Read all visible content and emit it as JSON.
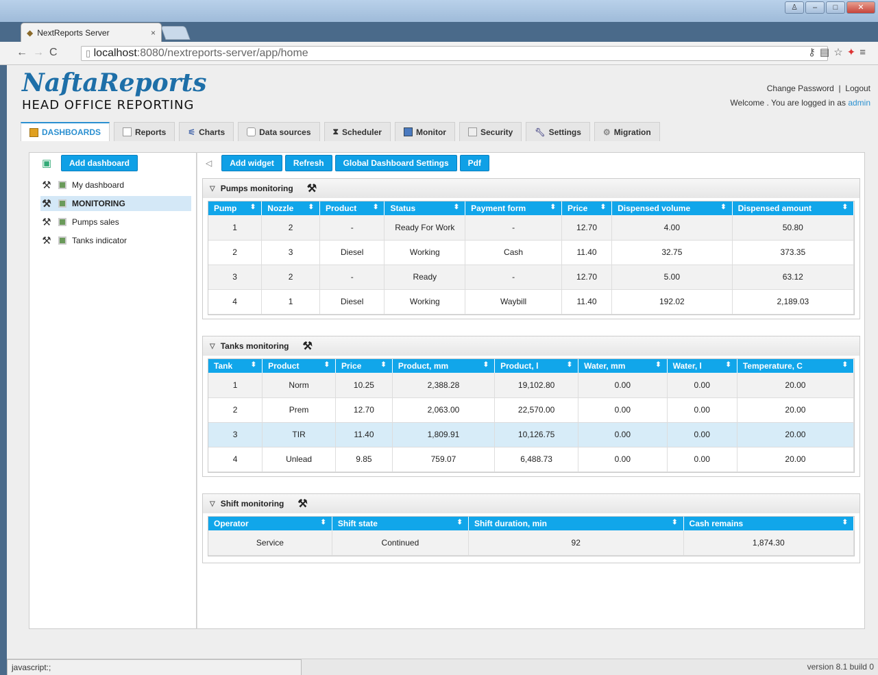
{
  "browser": {
    "tab_title": "NextReports Server",
    "url_host": "localhost",
    "url_rest": ":8080/nextreports-server/app/home",
    "close_glyph": "×"
  },
  "app": {
    "logo": "NaftaReports",
    "tagline": "HEAD OFFICE REPORTING",
    "change_password": "Change Password",
    "separator": "|",
    "logout": "Logout",
    "welcome": "Welcome . You are logged in as ",
    "user": "admin"
  },
  "nav_tabs": [
    {
      "label": "DASHBOARDS",
      "icon": "dashboard-icon"
    },
    {
      "label": "Reports",
      "icon": "reports-icon"
    },
    {
      "label": "Charts",
      "icon": "charts-icon"
    },
    {
      "label": "Data sources",
      "icon": "datasource-icon"
    },
    {
      "label": "Scheduler",
      "icon": "hourglass-icon"
    },
    {
      "label": "Monitor",
      "icon": "monitor-icon"
    },
    {
      "label": "Security",
      "icon": "security-icon"
    },
    {
      "label": "Settings",
      "icon": "wrench-icon"
    },
    {
      "label": "Migration",
      "icon": "migration-icon"
    }
  ],
  "sidebar": {
    "add_dashboard": "Add dashboard",
    "items": [
      "My dashboard",
      "MONITORING",
      "Pumps sales",
      "Tanks indicator"
    ]
  },
  "toolbar": {
    "add_widget": "Add widget",
    "refresh": "Refresh",
    "global_settings": "Global Dashboard Settings",
    "pdf": "Pdf"
  },
  "pumps": {
    "title": "Pumps monitoring",
    "columns": [
      "Pump",
      "Nozzle",
      "Product",
      "Status",
      "Payment form",
      "Price",
      "Dispensed volume",
      "Dispensed amount"
    ],
    "rows": [
      [
        "1",
        "2",
        "-",
        "Ready For Work",
        "-",
        "12.70",
        "4.00",
        "50.80"
      ],
      [
        "2",
        "3",
        "Diesel",
        "Working",
        "Cash",
        "11.40",
        "32.75",
        "373.35"
      ],
      [
        "3",
        "2",
        "-",
        "Ready",
        "-",
        "12.70",
        "5.00",
        "63.12"
      ],
      [
        "4",
        "1",
        "Diesel",
        "Working",
        "Waybill",
        "11.40",
        "192.02",
        "2,189.03"
      ]
    ]
  },
  "tanks": {
    "title": "Tanks monitoring",
    "columns": [
      "Tank",
      "Product",
      "Price",
      "Product, mm",
      "Product, l",
      "Water, mm",
      "Water, l",
      "Temperature, C"
    ],
    "rows": [
      [
        "1",
        "Norm",
        "10.25",
        "2,388.28",
        "19,102.80",
        "0.00",
        "0.00",
        "20.00"
      ],
      [
        "2",
        "Prem",
        "12.70",
        "2,063.00",
        "22,570.00",
        "0.00",
        "0.00",
        "20.00"
      ],
      [
        "3",
        "TIR",
        "11.40",
        "1,809.91",
        "10,126.75",
        "0.00",
        "0.00",
        "20.00"
      ],
      [
        "4",
        "Unlead",
        "9.85",
        "759.07",
        "6,488.73",
        "0.00",
        "0.00",
        "20.00"
      ]
    ]
  },
  "shift": {
    "title": "Shift monitoring",
    "columns": [
      "Operator",
      "Shift state",
      "Shift duration, min",
      "Cash remains"
    ],
    "rows": [
      [
        "Service",
        "Continued",
        "92",
        "1,874.30"
      ]
    ]
  },
  "status_bar": {
    "left": "javascript:;",
    "version": "version 8.1 build 0"
  },
  "colors": {
    "accent": "#11a6ea",
    "logo": "#1e6fa8"
  }
}
